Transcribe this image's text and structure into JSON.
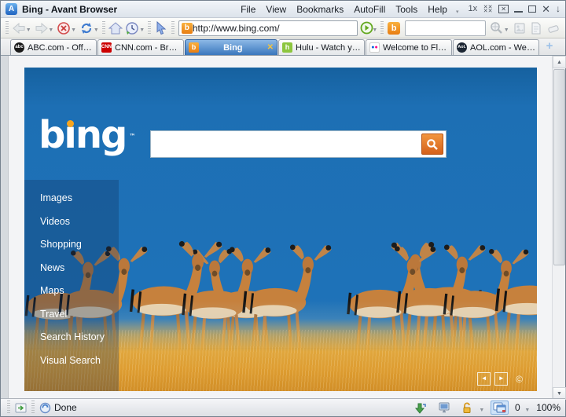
{
  "window": {
    "title": "Bing - Avant Browser",
    "app_initial": "A",
    "menus": [
      "File",
      "View",
      "Bookmarks",
      "AutoFill",
      "Tools",
      "Help"
    ],
    "controls": {
      "zoom_1x": "1x"
    }
  },
  "icons": {
    "menu_chevron": "▾",
    "grid_close": "✕✕✕✕",
    "box_close": "✕",
    "close": "✕",
    "drop_down": "↓",
    "caret_down": "▼",
    "scroll_up": "▲",
    "scroll_down": "▼",
    "new_tab": "+",
    "prev": "◄",
    "next": "►"
  },
  "toolbar": {
    "address": "http://www.bing.com/",
    "address_favicon": "b",
    "bing_icon": "b",
    "search_value": ""
  },
  "tabbar": {
    "tabs": [
      {
        "label": "ABC.com - Officia...",
        "favicon_text": "abc"
      },
      {
        "label": "CNN.com - Breaki...",
        "favicon_text": "CNN"
      },
      {
        "label": "Bing",
        "favicon_text": "b",
        "close": "✕"
      },
      {
        "label": "Hulu - Watch you...",
        "favicon_text": "h"
      },
      {
        "label": "Welcome to Flickr...",
        "favicon_d1": "●",
        "favicon_d2": "●"
      },
      {
        "label": "AOL.com - Welco...",
        "favicon_text": "Aol."
      }
    ],
    "new_tab": "+"
  },
  "page": {
    "logo_text": "bıng",
    "logo_tm": "™",
    "search_value": "",
    "nav": [
      "Images",
      "Videos",
      "Shopping",
      "News",
      "Maps",
      "Travel",
      "Search History",
      "Visual Search"
    ],
    "photo_prev": "◄",
    "photo_next": "►",
    "copyright": "©"
  },
  "statusbar": {
    "status": "Done",
    "popup_count": "0",
    "zoom": "100%"
  },
  "colors": {
    "sky": "#1e72b8",
    "grass": "#e0a63d",
    "search_button": "#e0762a",
    "active_tab": "#3a77bd",
    "bing_orange": "#f6a51e"
  }
}
